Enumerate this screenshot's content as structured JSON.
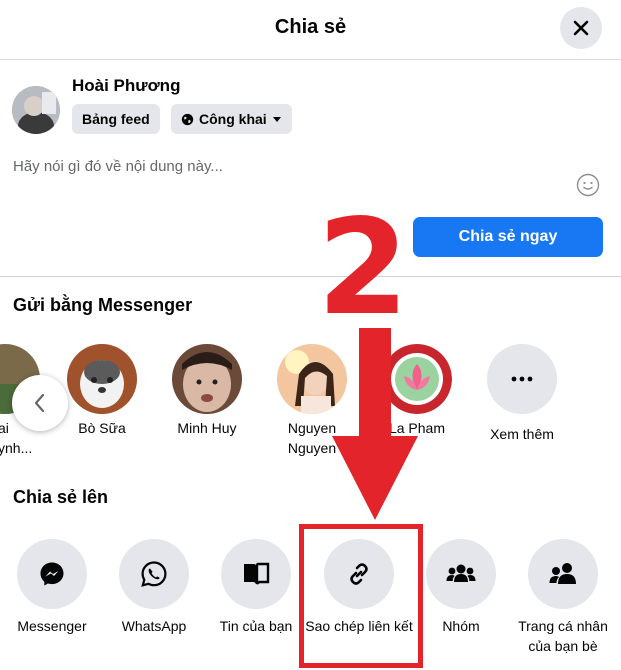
{
  "dialog": {
    "title": "Chia sẻ"
  },
  "composer": {
    "user_name": "Hoài Phương",
    "feed_chip": "Bảng feed",
    "audience_chip": "Công khai",
    "placeholder": "Hãy nói gì đó về nội dung này...",
    "share_now": "Chia sẻ ngay"
  },
  "messenger": {
    "section_title": "Gửi bằng Messenger",
    "partial_contact": "ai\nynh...",
    "contacts": [
      {
        "name": "Bò Sữa"
      },
      {
        "name": "Minh Huy"
      },
      {
        "name": "Nguyen Nguyen"
      },
      {
        "name": "La Pham"
      },
      {
        "name": "Xem thêm"
      }
    ]
  },
  "share_to": {
    "section_title": "Chia sẻ lên",
    "options": [
      {
        "label": "Messenger",
        "icon": "messenger-icon"
      },
      {
        "label": "WhatsApp",
        "icon": "whatsapp-icon"
      },
      {
        "label": "Tin của bạn",
        "icon": "book-icon"
      },
      {
        "label": "Sao chép liên kết",
        "icon": "link-icon"
      },
      {
        "label": "Nhóm",
        "icon": "group-icon"
      },
      {
        "label": "Trang cá nhân của bạn bè",
        "icon": "friends-icon"
      }
    ]
  },
  "annotation": {
    "step_number": "2",
    "color": "#e3242b"
  },
  "colors": {
    "primary": "#1877f2",
    "chip_bg": "#e4e6eb"
  }
}
